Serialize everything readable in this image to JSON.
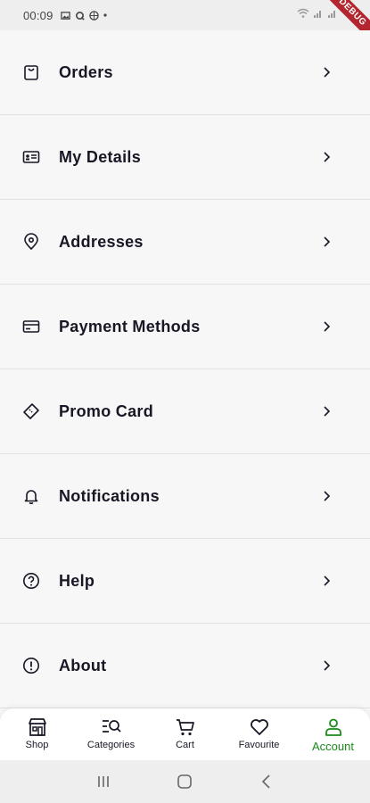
{
  "status_bar": {
    "time": "00:09"
  },
  "debug_banner": "DEBUG",
  "menu": {
    "items": [
      {
        "label": "Orders",
        "icon": "shopping-bag-icon"
      },
      {
        "label": "My Details",
        "icon": "id-card-icon"
      },
      {
        "label": "Addresses",
        "icon": "location-pin-icon"
      },
      {
        "label": "Payment Methods",
        "icon": "credit-card-icon"
      },
      {
        "label": "Promo Card",
        "icon": "ticket-icon"
      },
      {
        "label": "Notifications",
        "icon": "bell-icon"
      },
      {
        "label": "Help",
        "icon": "help-circle-icon"
      },
      {
        "label": "About",
        "icon": "info-circle-icon"
      }
    ]
  },
  "bottom_nav": {
    "items": [
      {
        "label": "Shop",
        "icon": "store-icon",
        "active": false
      },
      {
        "label": "Categories",
        "icon": "categories-search-icon",
        "active": false
      },
      {
        "label": "Cart",
        "icon": "cart-icon",
        "active": false
      },
      {
        "label": "Favourite",
        "icon": "heart-icon",
        "active": false
      },
      {
        "label": "Account",
        "icon": "user-icon",
        "active": true
      }
    ]
  },
  "colors": {
    "accent": "#1a8a1a",
    "text": "#181725",
    "background": "#f7f7f7"
  }
}
